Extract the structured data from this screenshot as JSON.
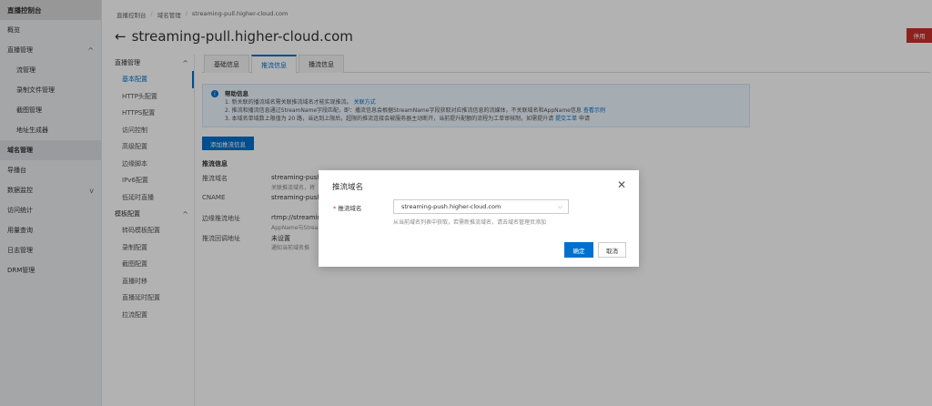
{
  "sidebar": {
    "header": "直播控制台",
    "items": [
      {
        "label": "概览",
        "sub": false,
        "active": false,
        "chev": ""
      },
      {
        "label": "直播管理",
        "sub": false,
        "active": false,
        "chev": "^"
      },
      {
        "label": "流管理",
        "sub": true,
        "active": false,
        "chev": ""
      },
      {
        "label": "录制文件管理",
        "sub": true,
        "active": false,
        "chev": ""
      },
      {
        "label": "截图管理",
        "sub": true,
        "active": false,
        "chev": ""
      },
      {
        "label": "地址生成器",
        "sub": true,
        "active": false,
        "chev": ""
      },
      {
        "label": "域名管理",
        "sub": false,
        "active": true,
        "chev": ""
      },
      {
        "label": "导播台",
        "sub": false,
        "active": false,
        "chev": ""
      },
      {
        "label": "数据监控",
        "sub": false,
        "active": false,
        "chev": "v"
      },
      {
        "label": "访问统计",
        "sub": false,
        "active": false,
        "chev": ""
      },
      {
        "label": "用量查询",
        "sub": false,
        "active": false,
        "chev": ""
      },
      {
        "label": "日志管理",
        "sub": false,
        "active": false,
        "chev": ""
      },
      {
        "label": "DRM管理",
        "sub": false,
        "active": false,
        "chev": ""
      }
    ]
  },
  "breadcrumb": [
    "直播控制台",
    "域名管理",
    "streaming-pull.higher-cloud.com"
  ],
  "page": {
    "title": "streaming-pull.higher-cloud.com",
    "back_icon": "arrow-left-icon",
    "stop_label": "停用"
  },
  "subnav": {
    "group1": "直播管理",
    "items1": [
      "基本配置",
      "HTTP头配置",
      "HTTPS配置",
      "访问控制",
      "高级配置",
      "边缘脚本",
      "IPv6配置",
      "低延时直播"
    ],
    "group2": "模板配置",
    "items2": [
      "转码模板配置",
      "录制配置",
      "截图配置",
      "直播时移",
      "直播延时配置",
      "拉流配置"
    ]
  },
  "tabs": [
    "基础信息",
    "推流信息",
    "播流信息"
  ],
  "help": {
    "title": "帮助信息",
    "line1": "1. 新关联的播流域名需关联推流域名才能实现推流。",
    "line1_link": "关联方式",
    "line2": "2. 推流和播流信息通过StreamName字段匹配，即：播流信息会根据StreamName字段获取对应推流信息的流媒体，不关联域名和AppName信息",
    "line2_link": "查看示例",
    "line3": "3. 本域名单域数上限值为 20 路，当达到上限后，超限的推流连接会被服务器主动断开，当前提升配额的流程为工单审核制，如需提升请",
    "line3_link": "提交工单",
    "line3_end": "申请"
  },
  "add_button": "添加推流信息",
  "section_title": "推流信息",
  "rows": [
    {
      "k": "推流域名",
      "v": "streaming-push.hi",
      "s": "关联推流域名，将"
    },
    {
      "k": "CNAME",
      "v": "streaming-push.hi",
      "s": ""
    },
    {
      "k": "边缘推流地址",
      "v": "rtmp://streaming",
      "s": "AppName与Strea"
    },
    {
      "k": "推流回调地址",
      "v": "未设置",
      "s": "通知当前域名推"
    }
  ],
  "modal": {
    "title": "推流域名",
    "label": "推流域名",
    "required_mark": "*",
    "selected": "streaming-push.higher-cloud.com",
    "hint": "从当前域名列表中获取，若需新推流域名，请去域名管理页添加",
    "ok": "确定",
    "cancel": "取消"
  }
}
